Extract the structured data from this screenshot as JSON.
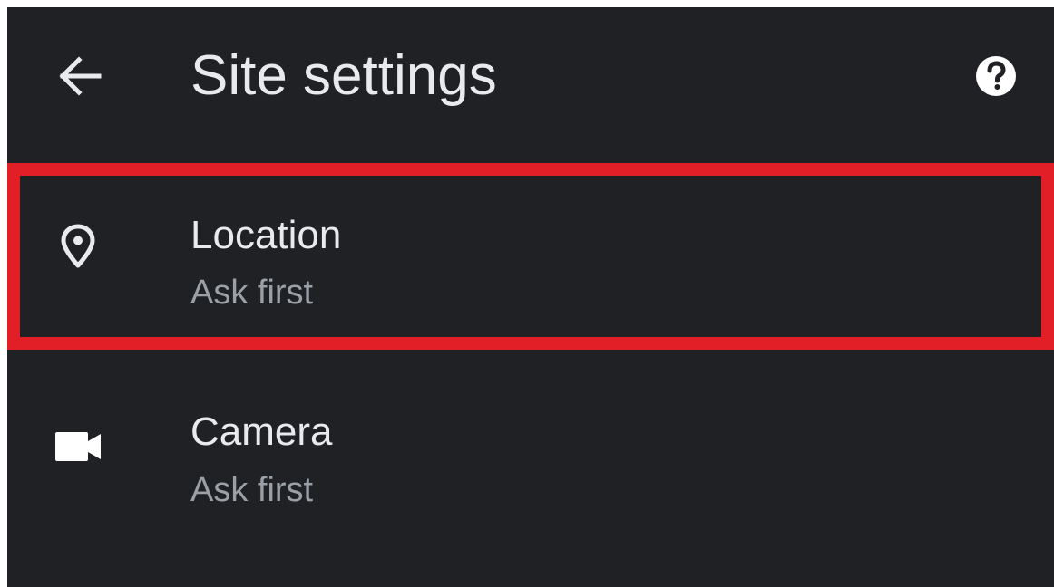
{
  "app_bar": {
    "title": "Site settings",
    "back_icon": "arrow-back-icon",
    "help_icon": "help-circle-icon"
  },
  "settings": [
    {
      "label": "Location",
      "value": "Ask first",
      "icon": "location-pin-icon",
      "highlighted": true
    },
    {
      "label": "Camera",
      "value": "Ask first",
      "icon": "videocam-icon",
      "highlighted": false
    }
  ],
  "colors": {
    "background": "#202124",
    "primary_text": "#e8eaed",
    "secondary_text": "#9aa0a6",
    "highlight": "#e21f26"
  }
}
